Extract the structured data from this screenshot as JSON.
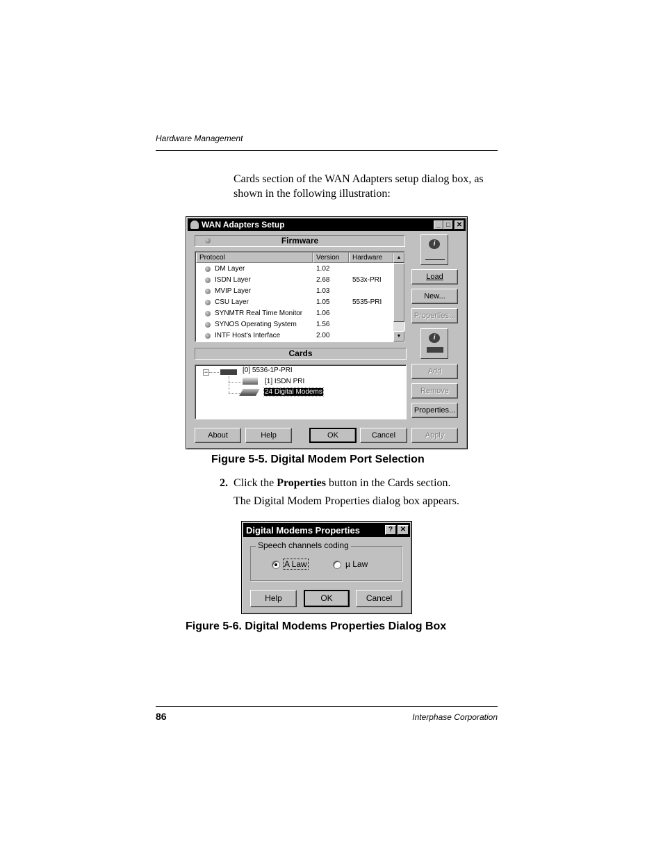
{
  "page": {
    "running_head": "Hardware Management",
    "intro_text": "Cards section of the WAN Adapters setup dialog box, as shown in the following illustration:",
    "figure1_caption": "Figure 5-5.  Digital Modem Port Selection",
    "step_number": "2.",
    "step_text_pre": "Click the ",
    "step_text_bold": "Properties",
    "step_text_post": " button in the Cards section.",
    "step_result": "The Digital Modem Properties dialog box appears.",
    "figure2_caption": "Figure 5-6.  Digital Modems Properties Dialog Box",
    "page_number": "86",
    "footer_company": "Interphase Corporation"
  },
  "wan_dialog": {
    "title": "WAN Adapters Setup",
    "title_buttons": [
      "_",
      "□",
      "✕"
    ],
    "firmware_label": "Firmware",
    "cards_label": "Cards",
    "columns": [
      "Protocol",
      "Version",
      "Hardware"
    ],
    "rows": [
      {
        "protocol": "DM Layer",
        "version": "1.02",
        "hardware": ""
      },
      {
        "protocol": "ISDN Layer",
        "version": "2.68",
        "hardware": "553x-PRI"
      },
      {
        "protocol": "MVIP Layer",
        "version": "1.03",
        "hardware": ""
      },
      {
        "protocol": "CSU Layer",
        "version": "1.05",
        "hardware": "5535-PRI"
      },
      {
        "protocol": "SYNMTR Real Time Monitor",
        "version": "1.06",
        "hardware": ""
      },
      {
        "protocol": "SYNOS Operating System",
        "version": "1.56",
        "hardware": ""
      },
      {
        "protocol": "INTF Host's Interface",
        "version": "2.00",
        "hardware": ""
      }
    ],
    "tree": {
      "root": "[0] 5536-1P-PRI",
      "children": [
        "[1] ISDN PRI",
        "24 Digital Modems"
      ],
      "selected": "24 Digital Modems"
    },
    "firmware_buttons": {
      "load": "Load",
      "new": "New...",
      "properties": "Properties..."
    },
    "cards_buttons": {
      "add": "Add",
      "remove": "Remove",
      "properties": "Properties..."
    },
    "bottom_buttons": {
      "about": "About",
      "help": "Help",
      "ok": "OK",
      "cancel": "Cancel",
      "apply": "Apply"
    }
  },
  "dm_dialog": {
    "title": "Digital Modems Properties",
    "title_buttons": [
      "?",
      "✕"
    ],
    "group_label": "Speech channels coding",
    "options": [
      {
        "label": "A Law",
        "selected": true
      },
      {
        "label": "µ Law",
        "selected": false
      }
    ],
    "buttons": {
      "help": "Help",
      "ok": "OK",
      "cancel": "Cancel"
    }
  }
}
